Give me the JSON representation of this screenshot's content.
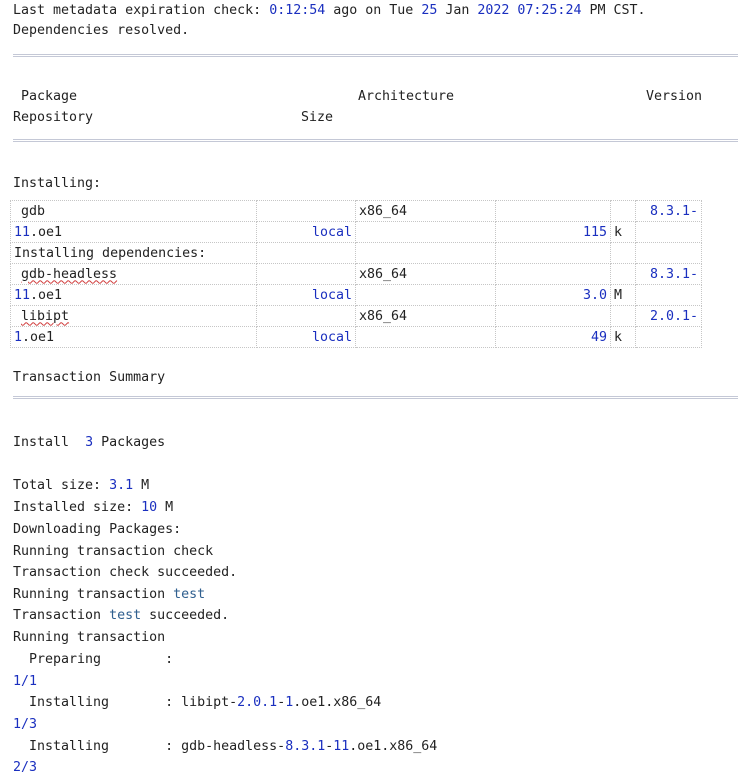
{
  "log_top": {
    "expiration": {
      "prefix": "Last metadata expiration check: ",
      "time": "0:12:54",
      "mid": " ago on Tue ",
      "day": "25",
      "mon": " Jan ",
      "year": "2022",
      "sp": " ",
      "clock": "07:25:24",
      "suffix": " PM CST."
    },
    "deps_resolved": "Dependencies resolved."
  },
  "separator": "================================================================================",
  "table_header": {
    "package": "Package",
    "architecture": "Architecture",
    "version": "Version",
    "repository": "Repository",
    "size": "Size"
  },
  "installing_label": "Installing:",
  "installing_deps_label": "Installing dependencies:",
  "packages": [
    {
      "name": "gdb",
      "arch": "x86_64",
      "ver_a": "8.3.1-",
      "ver_b1": "11",
      "ver_b2": ".oe1",
      "repo": "local",
      "size_num": "115",
      "size_unit": "k"
    },
    {
      "name": "gdb-headless",
      "arch": "x86_64",
      "ver_a": "8.3.1-",
      "ver_b1": "11",
      "ver_b2": ".oe1",
      "repo": "local",
      "size_num": "3.0",
      "size_unit": "M"
    },
    {
      "name": "libipt",
      "arch": "x86_64",
      "ver_a": "2.0.1-",
      "ver_b1": "1",
      "ver_b2": ".oe1",
      "repo": "local",
      "size_num": "49",
      "size_unit": "k"
    }
  ],
  "summary": {
    "title": "Transaction Summary",
    "install_label": "Install  ",
    "install_count": "3",
    "install_suffix": " Packages",
    "total_size_label": "Total size: ",
    "total_size_num": "3.1",
    "total_size_unit": " M",
    "installed_size_label": "Installed size: ",
    "installed_size_num": "10",
    "installed_size_unit": " M"
  },
  "log_bottom": {
    "downloading": "Downloading Packages:",
    "check_a": "Running transaction check",
    "check_ok": "Transaction check succeeded.",
    "test_a": "Running transaction ",
    "test_kw": "test",
    "test_ok_a": "Transaction ",
    "test_ok_kw": "test",
    "test_ok_b": " succeeded.",
    "running": "Running transaction",
    "preparing": "  Preparing        :",
    "step1": "1/1",
    "inst1_a": "  Installing       : libipt-",
    "inst1_n1": "2.0.1",
    "inst1_d": "-",
    "inst1_n2": "1",
    "inst1_b": ".oe1.x86_64",
    "step2": "1/3",
    "inst2_a": "  Installing       : gdb-headless-",
    "inst2_n1": "8.3.1",
    "inst2_d": "-",
    "inst2_n2": "11",
    "inst2_b": ".oe1.x86_64",
    "step3": "2/3"
  }
}
